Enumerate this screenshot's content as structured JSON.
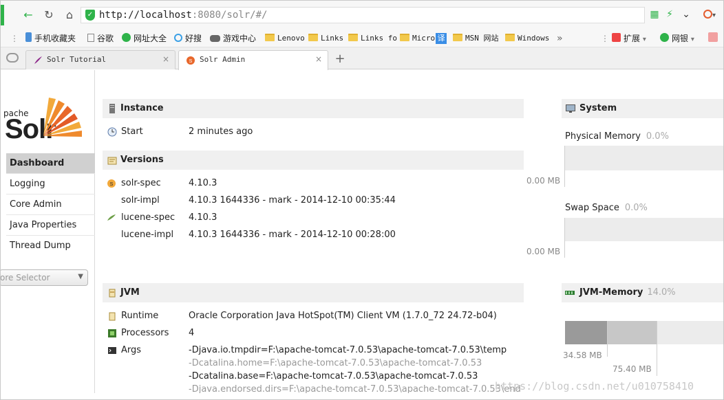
{
  "browser": {
    "url_host": "http://localhost",
    "url_rest": ":8080/solr/#/",
    "bookmarks": [
      "手机收藏夹",
      "谷歌",
      "网址大全",
      "好搜",
      "游戏中心",
      "Lenovo",
      "Links",
      "Links fo",
      "Micro",
      "MSN 网站",
      "Windows",
      "»",
      "扩展",
      "网银"
    ],
    "tabs": [
      {
        "label": "Solr Tutorial",
        "close": "×"
      },
      {
        "label": "Solr Admin",
        "close": "×"
      }
    ],
    "new_tab": "+"
  },
  "sidebar": {
    "logo_apache": "pache",
    "logo_solr": "Solr",
    "items": [
      "Dashboard",
      "Logging",
      "Core Admin",
      "Java Properties",
      "Thread Dump"
    ],
    "core_selector": "ore Selector"
  },
  "instance": {
    "title": "Instance",
    "start_label": "Start",
    "start_value": "2 minutes ago"
  },
  "versions": {
    "title": "Versions",
    "rows": [
      {
        "label": "solr-spec",
        "value": "4.10.3"
      },
      {
        "label": "solr-impl",
        "value": "4.10.3 1644336 - mark - 2014-12-10 00:35:44"
      },
      {
        "label": "lucene-spec",
        "value": "4.10.3"
      },
      {
        "label": "lucene-impl",
        "value": "4.10.3 1644336 - mark - 2014-12-10 00:28:00"
      }
    ]
  },
  "jvm": {
    "title": "JVM",
    "runtime_label": "Runtime",
    "runtime_value": "Oracle Corporation Java HotSpot(TM) Client VM (1.7.0_72 24.72-b04)",
    "processors_label": "Processors",
    "processors_value": "4",
    "args_label": "Args",
    "args": [
      "-Djava.io.tmpdir=F:\\apache-tomcat-7.0.53\\apache-tomcat-7.0.53\\temp",
      "-Dcatalina.home=F:\\apache-tomcat-7.0.53\\apache-tomcat-7.0.53",
      "-Dcatalina.base=F:\\apache-tomcat-7.0.53\\apache-tomcat-7.0.53",
      "-Djava.endorsed.dirs=F:\\apache-tomcat-7.0.53\\apache-tomcat-7.0.53\\end"
    ]
  },
  "system": {
    "title": "System",
    "physical_label": "Physical Memory",
    "physical_pct": "0.0%",
    "physical_axis": "0.00 MB",
    "swap_label": "Swap Space",
    "swap_pct": "0.0%",
    "swap_axis": "0.00 MB"
  },
  "jvm_memory": {
    "title": "JVM-Memory",
    "pct": "14.0%",
    "used_axis": "34.58 MB",
    "allocated_axis": "75.40 MB",
    "used_fraction": 0.14,
    "allocated_fraction": 0.305
  },
  "watermark": "https://blog.csdn.net/u010758410",
  "colors": {
    "accent_green": "#2fb34a",
    "solr_orange": "#e8672b",
    "active_nav": "#d0d0d0"
  }
}
